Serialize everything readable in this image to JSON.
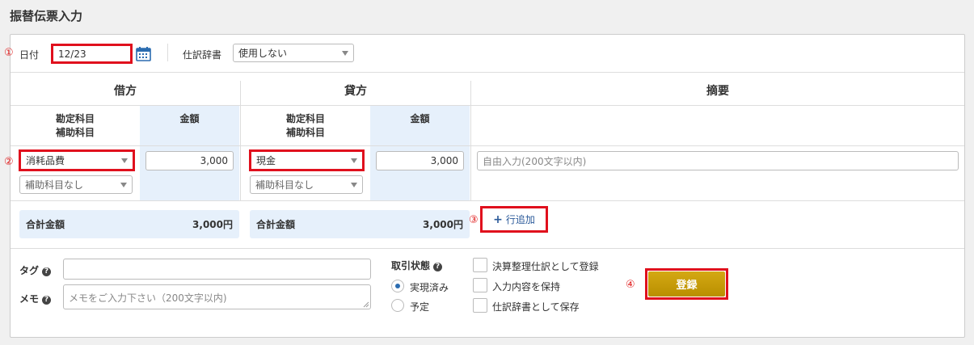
{
  "page": {
    "title": "振替伝票入力"
  },
  "markers": {
    "m1": "①",
    "m2": "②",
    "m3": "③",
    "m4": "④"
  },
  "top": {
    "date_label": "日付",
    "date_value": "12/23",
    "dict_label": "仕訳辞書",
    "dict_value": "使用しない"
  },
  "headers": {
    "debit": "借方",
    "credit": "貸方",
    "summary": "摘要"
  },
  "subheaders": {
    "account_line1": "勘定科目",
    "account_line2": "補助科目",
    "amount": "金額"
  },
  "debit": {
    "account": "消耗品費",
    "sub_account": "補助科目なし",
    "amount": "3,000"
  },
  "credit": {
    "account": "現金",
    "sub_account": "補助科目なし",
    "amount": "3,000"
  },
  "summary": {
    "placeholder": "自由入力(200文字以内)"
  },
  "totals": {
    "debit_label": "合計金額",
    "debit_value": "3,000円",
    "credit_label": "合計金額",
    "credit_value": "3,000円"
  },
  "add_row": {
    "icon": "+",
    "label": "行追加"
  },
  "bottom": {
    "tag_label": "タグ",
    "memo_label": "メモ",
    "memo_placeholder": "メモをご入力下さい（200文字以内)",
    "help_icon": "?",
    "status_label": "取引状態",
    "status_options": [
      "実現済み",
      "予定"
    ],
    "status_selected": "実現済み",
    "checkboxes": [
      "決算整理仕訳として登録",
      "入力内容を保持",
      "仕訳辞書として保存"
    ]
  },
  "register_button": "登録",
  "colors": {
    "accent_red": "#e0101d",
    "register_gold": "#c99e08",
    "header_blue": "#e6f0fb",
    "link_blue": "#2b5a9a"
  }
}
